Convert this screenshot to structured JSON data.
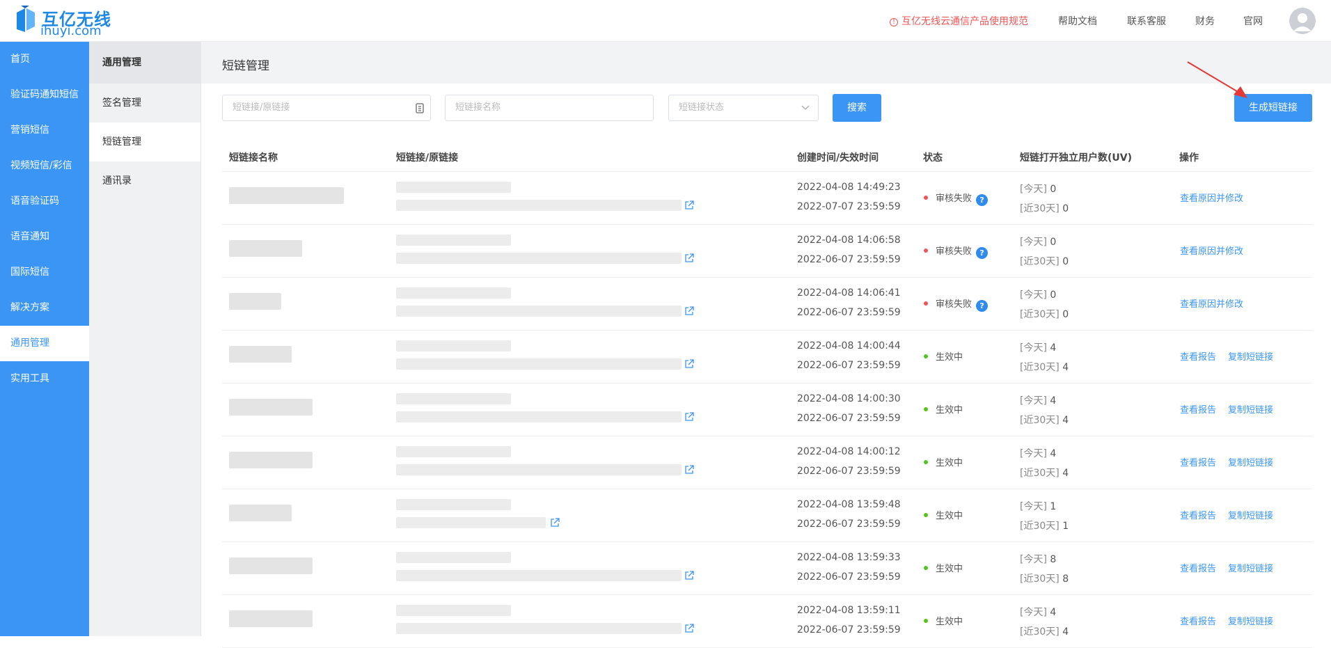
{
  "brand": {
    "name_cn": "互亿无线",
    "name_en": "ihuyi.com",
    "color": "#1e88e5"
  },
  "header": {
    "notice": "互亿无线云通信产品使用规范",
    "nav": [
      "帮助文档",
      "联系客服",
      "财务",
      "官网"
    ]
  },
  "sidebar": {
    "items": [
      {
        "label": "首页"
      },
      {
        "label": "验证码通知短信"
      },
      {
        "label": "营销短信"
      },
      {
        "label": "视频短信/彩信"
      },
      {
        "label": "语音验证码"
      },
      {
        "label": "语音通知"
      },
      {
        "label": "国际短信"
      },
      {
        "label": "解决方案"
      },
      {
        "label": "通用管理",
        "active": true
      },
      {
        "label": "实用工具"
      }
    ]
  },
  "subsidebar": {
    "items": [
      {
        "label": "通用管理"
      },
      {
        "label": "签名管理"
      },
      {
        "label": "短链管理",
        "active": true
      },
      {
        "label": "通讯录"
      }
    ]
  },
  "page": {
    "title": "短链管理"
  },
  "filters": {
    "link_placeholder": "短链接/原链接",
    "name_placeholder": "短链接名称",
    "status_placeholder": "短链接状态",
    "search_label": "搜索",
    "create_label": "生成短链接"
  },
  "table": {
    "columns": [
      "短链接名称",
      "短链接/原链接",
      "创建时间/失效时间",
      "状态",
      "短链打开独立用户数(UV)",
      "操作"
    ],
    "today_prefix": "[今天]",
    "month_prefix": "[近30天]",
    "rows": [
      {
        "created": "2022-04-08 14:49:23",
        "expires": "2022-07-07 23:59:59",
        "status": "审核失败",
        "status_color": "#f05454",
        "today": "0",
        "month": "0",
        "actions": [
          "查看原因并修改"
        ]
      },
      {
        "created": "2022-04-08 14:06:58",
        "expires": "2022-06-07 23:59:59",
        "status": "审核失败",
        "status_color": "#f05454",
        "today": "0",
        "month": "0",
        "actions": [
          "查看原因并修改"
        ]
      },
      {
        "created": "2022-04-08 14:06:41",
        "expires": "2022-06-07 23:59:59",
        "status": "审核失败",
        "status_color": "#f05454",
        "today": "0",
        "month": "0",
        "actions": [
          "查看原因并修改"
        ]
      },
      {
        "created": "2022-04-08 14:00:44",
        "expires": "2022-06-07 23:59:59",
        "status": "生效中",
        "status_color": "#52c41a",
        "today": "4",
        "month": "4",
        "actions": [
          "查看报告",
          "复制短链接"
        ]
      },
      {
        "created": "2022-04-08 14:00:30",
        "expires": "2022-06-07 23:59:59",
        "status": "生效中",
        "status_color": "#52c41a",
        "today": "4",
        "month": "4",
        "actions": [
          "查看报告",
          "复制短链接"
        ]
      },
      {
        "created": "2022-04-08 14:00:12",
        "expires": "2022-06-07 23:59:59",
        "status": "生效中",
        "status_color": "#52c41a",
        "today": "4",
        "month": "4",
        "actions": [
          "查看报告",
          "复制短链接"
        ]
      },
      {
        "created": "2022-04-08 13:59:48",
        "expires": "2022-06-07 23:59:59",
        "status": "生效中",
        "status_color": "#52c41a",
        "today": "1",
        "month": "1",
        "actions": [
          "查看报告",
          "复制短链接"
        ]
      },
      {
        "created": "2022-04-08 13:59:33",
        "expires": "2022-06-07 23:59:59",
        "status": "生效中",
        "status_color": "#52c41a",
        "today": "8",
        "month": "8",
        "actions": [
          "查看报告",
          "复制短链接"
        ]
      },
      {
        "created": "2022-04-08 13:59:11",
        "expires": "2022-06-07 23:59:59",
        "status": "生效中",
        "status_color": "#52c41a",
        "today": "4",
        "month": "4",
        "actions": [
          "查看报告",
          "复制短链接"
        ]
      }
    ]
  }
}
